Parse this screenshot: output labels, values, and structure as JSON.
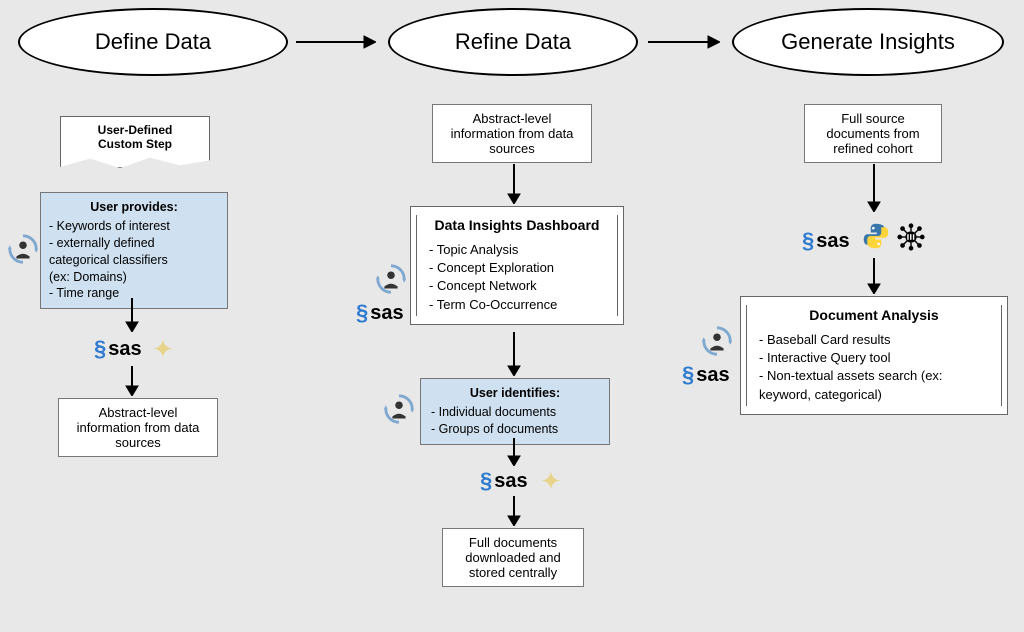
{
  "stages": {
    "define": "Define Data",
    "refine": "Refine Data",
    "generate": "Generate Insights"
  },
  "define_col": {
    "custom_step": "User-Defined\nCustom Step",
    "user_provides_title": "User provides:",
    "user_provides_items": "- Keywords of interest\n- externally defined\ncategorical classifiers\n(ex: Domains)\n- Time range",
    "abstract_info": "Abstract-level\ninformation from data\nsources"
  },
  "refine_col": {
    "abstract_info": "Abstract-level\ninformation from data\nsources",
    "dashboard_title": "Data Insights Dashboard",
    "dashboard_items": [
      "Topic Analysis",
      "Concept Exploration",
      "Concept Network",
      "Term Co-Occurrence"
    ],
    "user_identifies_title": "User identifies:",
    "user_identifies_items": "- Individual documents\n- Groups of documents",
    "full_docs": "Full documents\ndownloaded and\nstored centrally"
  },
  "generate_col": {
    "full_source": "Full source\ndocuments from\nrefined cohort",
    "doc_analysis_title": "Document Analysis",
    "doc_analysis_items": [
      "Baseball Card results",
      "Interactive Query tool",
      "Non-textual assets search (ex: keyword, categorical)"
    ]
  },
  "logos": {
    "sas": "sas"
  }
}
